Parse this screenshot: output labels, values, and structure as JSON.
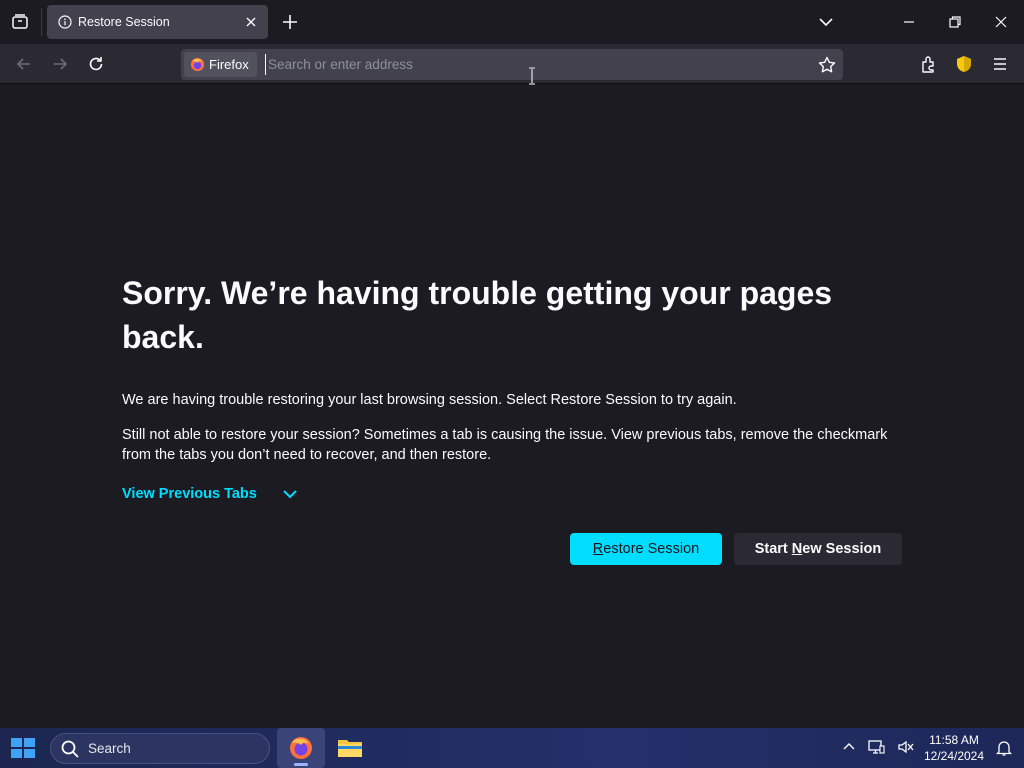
{
  "browser": {
    "tab": {
      "title": "Restore Session"
    },
    "urlbar": {
      "identity_label": "Firefox",
      "placeholder": "Search or enter address",
      "value": ""
    }
  },
  "page": {
    "title": "Sorry. We’re having trouble getting your pages back.",
    "p1": "We are having trouble restoring your last browsing session. Select Restore Session to try again.",
    "p2": "Still not able to restore your session? Sometimes a tab is causing the issue. View previous tabs, remove the checkmark from the tabs you don’t need to recover, and then restore.",
    "view_previous_tabs": "View Previous Tabs",
    "restore_btn": {
      "pre": "",
      "ul": "R",
      "post": "estore Session"
    },
    "new_btn": {
      "pre": "Start ",
      "ul": "N",
      "post": "ew Session"
    }
  },
  "taskbar": {
    "search_label": "Search",
    "clock_time": "11:58 AM",
    "clock_date": "12/24/2024"
  },
  "colors": {
    "accent": "#00ddff",
    "tab_bg": "#42414d",
    "page_bg": "#1c1b22",
    "toolbar_bg": "#2b2a33"
  },
  "icons": [
    "tab-list-icon",
    "info-icon",
    "close-icon",
    "plus-icon",
    "chevron-down-icon",
    "minimize-icon",
    "restore-icon",
    "window-close-icon",
    "back-icon",
    "forward-icon",
    "reload-icon",
    "firefox-logo-icon",
    "bookmark-star-icon",
    "extensions-icon",
    "shield-icon",
    "menu-icon",
    "windows-start-icon",
    "search-icon",
    "firefox-icon",
    "file-explorer-icon",
    "tray-chevron-icon",
    "network-icon",
    "volume-icon",
    "notification-icon"
  ]
}
